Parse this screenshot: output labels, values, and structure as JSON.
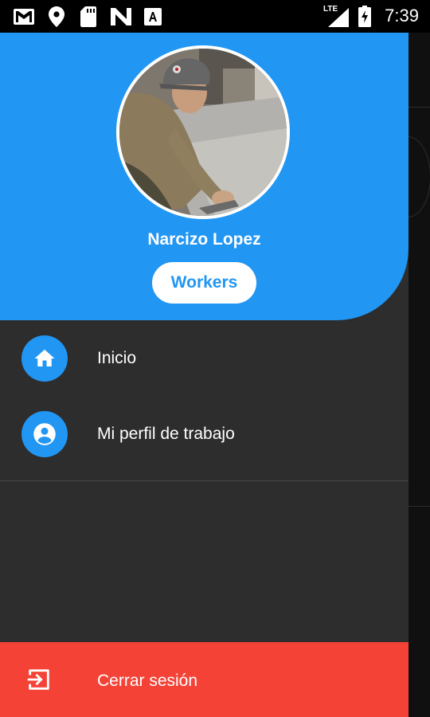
{
  "status_bar": {
    "time": "7:39",
    "network": "LTE",
    "icons": [
      "gmail-icon",
      "location-icon",
      "sd-card-icon",
      "n-app-icon",
      "a-app-icon",
      "signal-icon",
      "battery-charging-icon"
    ]
  },
  "drawer": {
    "user_name": "Narcizo Lopez",
    "role_button": "Workers",
    "menu": [
      {
        "label": "Inicio",
        "icon": "home-icon"
      },
      {
        "label": "Mi perfil de trabajo",
        "icon": "account-circle-icon"
      }
    ],
    "logout": {
      "label": "Cerrar sesión",
      "icon": "exit-icon"
    }
  },
  "colors": {
    "accent": "#2196f3",
    "drawer_bg": "#2d2d2d",
    "logout_bg": "#f44336",
    "status_bar": "#000000"
  }
}
